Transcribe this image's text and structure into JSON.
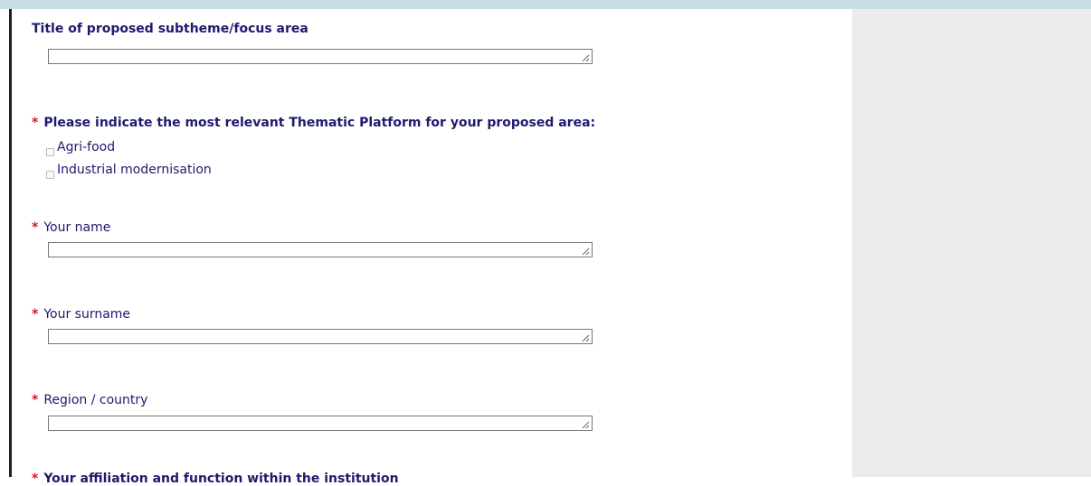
{
  "form": {
    "subtheme_label": "Title of proposed subtheme/focus area",
    "platform_label": "Please indicate the most relevant Thematic Platform for your proposed area:",
    "platform_options": [
      "Agri-food",
      "Industrial modernisation"
    ],
    "name_label": "Your name",
    "surname_label": "Your surname",
    "region_label": "Region / country",
    "affiliation_label": "Your affiliation and function within the institution",
    "required_marker": "*"
  },
  "colors": {
    "label": "#1e1a6e",
    "required": "#d8141b",
    "top_band": "#c6dfe6",
    "sidebar": "#ececec"
  }
}
